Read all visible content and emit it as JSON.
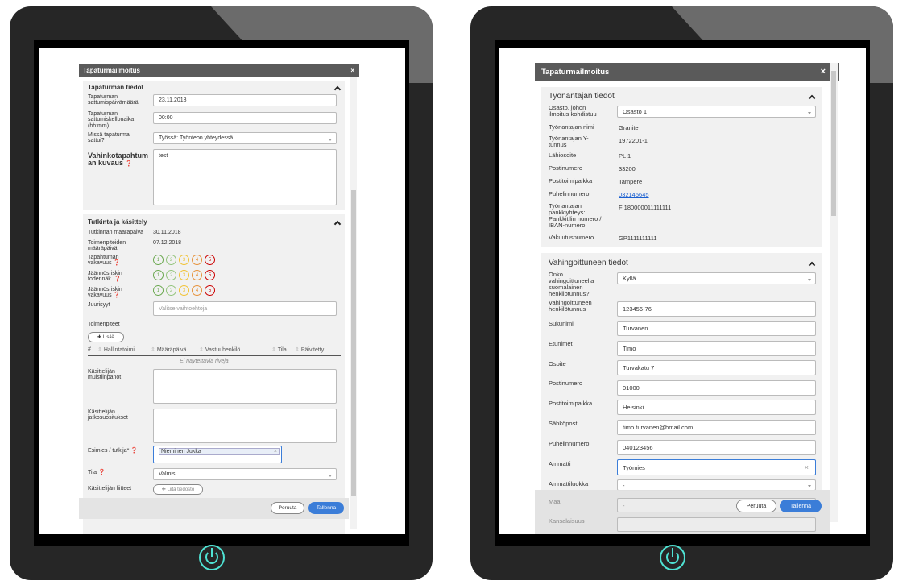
{
  "left": {
    "dialog_title": "Tapaturmailmoitus",
    "close": "×",
    "section1": {
      "title": "Tapaturman tiedot",
      "date_label": "Tapaturman sattumispäivämäärä",
      "date_value": "23.11.2018",
      "time_label": "Tapaturman sattumiskellonaika (hh:mm)",
      "time_value": "00:00",
      "place_label": "Missä tapaturma sattui?",
      "place_value": "Työssä: Työnteon yhteydessä",
      "desc_label": "Vahinkotapahtum an kuvaus",
      "desc_value": "test"
    },
    "section2": {
      "title": "Tutkinta ja käsittely",
      "due_label": "Tutkinnan määräpäivä",
      "due_value": "30.11.2018",
      "actions_due_label": "Toimenpiteiden määräpäivä",
      "actions_due_value": "07.12.2018",
      "severity_label": "Tapahtuman vakavuus",
      "probability_label": "Jäännösriskin todennäk.",
      "risk_severity_label": "Jäännösriskin vakavuus",
      "circles": [
        "1",
        "2",
        "3",
        "4",
        "5"
      ],
      "circle_colors": [
        "#6aa84f",
        "#93c47d",
        "#f1c232",
        "#e69138",
        "#cc0000"
      ],
      "root_label": "Juurisyyt",
      "root_placeholder": "Valitse vaihtoehtoja",
      "measures_label": "Toimenpiteet",
      "add_button": "Lisää",
      "table_headers": [
        "#",
        "Hallintatoimi",
        "Määräpäivä",
        "Vastuuhenkilö",
        "Tila",
        "Päivitetty"
      ],
      "empty_text": "Ei näytettäviä rivejä",
      "notes_label": "Käsittelijän muistiinpanot",
      "followup_label": "Käsittelijän jatkosuositukset",
      "supervisor_label": "Esimies / tutkija*",
      "supervisor_value": "Nieminen Jukka",
      "status_label": "Tila",
      "status_value": "Valmis",
      "attachments_label": "Käsittelijän liitteet",
      "attach_button": "Liitä tiedosto"
    },
    "cancel": "Peruuta",
    "save": "Tallenna"
  },
  "right": {
    "dialog_title": "Tapaturmailmoitus",
    "close": "×",
    "employer": {
      "title": "Työnantajan tiedot",
      "dept_label": "Osasto, johon ilmoitus kohdistuu",
      "dept_value": "Osasto 1",
      "name_label": "Työnantajan nimi",
      "name_value": "Granite",
      "ytunnus_label": "Työnantajan Y-tunnus",
      "ytunnus_value": "1972201-1",
      "address_label": "Lähiosoite",
      "address_value": "PL 1",
      "postal_label": "Postinumero",
      "postal_value": "33200",
      "city_label": "Postitoimipaikka",
      "city_value": "Tampere",
      "phone_label": "Puhelinnumero",
      "phone_value": "032145645",
      "iban_label": "Työnantajan pankkiyhteys: Pankkitilin numero / IBAN-numero",
      "iban_value": "FI180000011111111",
      "insurance_label": "Vakuutusnumero",
      "insurance_value": "GP1111111111"
    },
    "injured": {
      "title": "Vahingoittuneen tiedot",
      "finnish_id_label": "Onko vahingoittuneella suomalainen henkilötunnus?",
      "finnish_id_value": "Kyllä",
      "ssn_label": "Vahingoittuneen henkilötunnus",
      "ssn_value": "123456-76",
      "surname_label": "Sukunimi",
      "surname_value": "Turvanen",
      "firstnames_label": "Etunimet",
      "firstnames_value": "Timo",
      "address_label": "Osoite",
      "address_value": "Turvakatu 7",
      "postal_label": "Postinumero",
      "postal_value": "01000",
      "city_label": "Postitoimipaikka",
      "city_value": "Helsinki",
      "email_label": "Sähköposti",
      "email_value": "timo.turvanen@hmail.com",
      "phone_label": "Puhelinnumero",
      "phone_value": "040123456",
      "occupation_label": "Ammatti",
      "occupation_value": "Työmies",
      "class_label": "Ammattiluokka",
      "class_value": "-",
      "country_label": "Maa",
      "country_value": "-",
      "nationality_label": "Kansalaisuus"
    },
    "cancel": "Peruuta",
    "save": "Tallenna"
  },
  "colors": {
    "accent": "#3b7dd8",
    "title_bar": "#5a5a5a",
    "power_led": "#4fe3d4"
  }
}
